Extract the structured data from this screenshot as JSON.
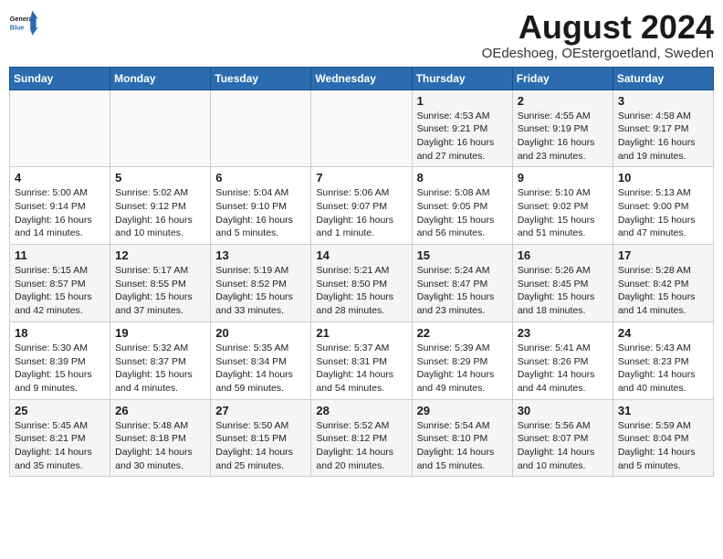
{
  "logo": {
    "text_general": "General",
    "text_blue": "Blue"
  },
  "title": "August 2024",
  "location": "OEdeshoeg, OEstergoetland, Sweden",
  "days_of_week": [
    "Sunday",
    "Monday",
    "Tuesday",
    "Wednesday",
    "Thursday",
    "Friday",
    "Saturday"
  ],
  "weeks": [
    [
      {
        "day": "",
        "info": ""
      },
      {
        "day": "",
        "info": ""
      },
      {
        "day": "",
        "info": ""
      },
      {
        "day": "",
        "info": ""
      },
      {
        "day": "1",
        "info": "Sunrise: 4:53 AM\nSunset: 9:21 PM\nDaylight: 16 hours\nand 27 minutes."
      },
      {
        "day": "2",
        "info": "Sunrise: 4:55 AM\nSunset: 9:19 PM\nDaylight: 16 hours\nand 23 minutes."
      },
      {
        "day": "3",
        "info": "Sunrise: 4:58 AM\nSunset: 9:17 PM\nDaylight: 16 hours\nand 19 minutes."
      }
    ],
    [
      {
        "day": "4",
        "info": "Sunrise: 5:00 AM\nSunset: 9:14 PM\nDaylight: 16 hours\nand 14 minutes."
      },
      {
        "day": "5",
        "info": "Sunrise: 5:02 AM\nSunset: 9:12 PM\nDaylight: 16 hours\nand 10 minutes."
      },
      {
        "day": "6",
        "info": "Sunrise: 5:04 AM\nSunset: 9:10 PM\nDaylight: 16 hours\nand 5 minutes."
      },
      {
        "day": "7",
        "info": "Sunrise: 5:06 AM\nSunset: 9:07 PM\nDaylight: 16 hours\nand 1 minute."
      },
      {
        "day": "8",
        "info": "Sunrise: 5:08 AM\nSunset: 9:05 PM\nDaylight: 15 hours\nand 56 minutes."
      },
      {
        "day": "9",
        "info": "Sunrise: 5:10 AM\nSunset: 9:02 PM\nDaylight: 15 hours\nand 51 minutes."
      },
      {
        "day": "10",
        "info": "Sunrise: 5:13 AM\nSunset: 9:00 PM\nDaylight: 15 hours\nand 47 minutes."
      }
    ],
    [
      {
        "day": "11",
        "info": "Sunrise: 5:15 AM\nSunset: 8:57 PM\nDaylight: 15 hours\nand 42 minutes."
      },
      {
        "day": "12",
        "info": "Sunrise: 5:17 AM\nSunset: 8:55 PM\nDaylight: 15 hours\nand 37 minutes."
      },
      {
        "day": "13",
        "info": "Sunrise: 5:19 AM\nSunset: 8:52 PM\nDaylight: 15 hours\nand 33 minutes."
      },
      {
        "day": "14",
        "info": "Sunrise: 5:21 AM\nSunset: 8:50 PM\nDaylight: 15 hours\nand 28 minutes."
      },
      {
        "day": "15",
        "info": "Sunrise: 5:24 AM\nSunset: 8:47 PM\nDaylight: 15 hours\nand 23 minutes."
      },
      {
        "day": "16",
        "info": "Sunrise: 5:26 AM\nSunset: 8:45 PM\nDaylight: 15 hours\nand 18 minutes."
      },
      {
        "day": "17",
        "info": "Sunrise: 5:28 AM\nSunset: 8:42 PM\nDaylight: 15 hours\nand 14 minutes."
      }
    ],
    [
      {
        "day": "18",
        "info": "Sunrise: 5:30 AM\nSunset: 8:39 PM\nDaylight: 15 hours\nand 9 minutes."
      },
      {
        "day": "19",
        "info": "Sunrise: 5:32 AM\nSunset: 8:37 PM\nDaylight: 15 hours\nand 4 minutes."
      },
      {
        "day": "20",
        "info": "Sunrise: 5:35 AM\nSunset: 8:34 PM\nDaylight: 14 hours\nand 59 minutes."
      },
      {
        "day": "21",
        "info": "Sunrise: 5:37 AM\nSunset: 8:31 PM\nDaylight: 14 hours\nand 54 minutes."
      },
      {
        "day": "22",
        "info": "Sunrise: 5:39 AM\nSunset: 8:29 PM\nDaylight: 14 hours\nand 49 minutes."
      },
      {
        "day": "23",
        "info": "Sunrise: 5:41 AM\nSunset: 8:26 PM\nDaylight: 14 hours\nand 44 minutes."
      },
      {
        "day": "24",
        "info": "Sunrise: 5:43 AM\nSunset: 8:23 PM\nDaylight: 14 hours\nand 40 minutes."
      }
    ],
    [
      {
        "day": "25",
        "info": "Sunrise: 5:45 AM\nSunset: 8:21 PM\nDaylight: 14 hours\nand 35 minutes."
      },
      {
        "day": "26",
        "info": "Sunrise: 5:48 AM\nSunset: 8:18 PM\nDaylight: 14 hours\nand 30 minutes."
      },
      {
        "day": "27",
        "info": "Sunrise: 5:50 AM\nSunset: 8:15 PM\nDaylight: 14 hours\nand 25 minutes."
      },
      {
        "day": "28",
        "info": "Sunrise: 5:52 AM\nSunset: 8:12 PM\nDaylight: 14 hours\nand 20 minutes."
      },
      {
        "day": "29",
        "info": "Sunrise: 5:54 AM\nSunset: 8:10 PM\nDaylight: 14 hours\nand 15 minutes."
      },
      {
        "day": "30",
        "info": "Sunrise: 5:56 AM\nSunset: 8:07 PM\nDaylight: 14 hours\nand 10 minutes."
      },
      {
        "day": "31",
        "info": "Sunrise: 5:59 AM\nSunset: 8:04 PM\nDaylight: 14 hours\nand 5 minutes."
      }
    ]
  ]
}
